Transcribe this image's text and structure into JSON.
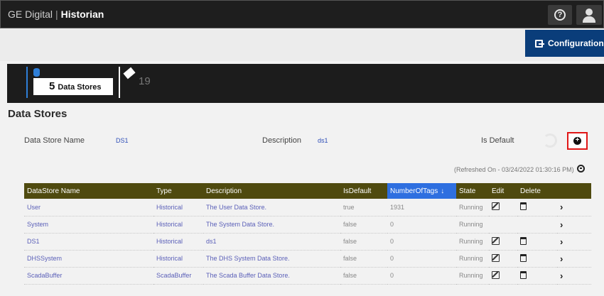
{
  "header": {
    "brand": "GE Digital",
    "app_name": "Historian",
    "help_icon": "help-circle-icon",
    "user_icon": "user-icon"
  },
  "toolbar": {
    "configuration_label": "Configuration",
    "configuration_icon": "configuration-icon"
  },
  "stats": {
    "data_stores_count": "5",
    "data_stores_label": "Data Stores",
    "tags_count": "19"
  },
  "page": {
    "title": "Data Stores"
  },
  "details": {
    "name_label": "Data Store Name",
    "name_value": "DS1",
    "description_label": "Description",
    "description_value": "ds1",
    "is_default_label": "Is Default"
  },
  "refreshed_text": "(Refreshed On - 03/24/2022 01:30:16 PM)",
  "table": {
    "columns": [
      "DataStore Name",
      "Type",
      "Description",
      "IsDefault",
      "NumberOfTags",
      "State",
      "Edit",
      "Delete"
    ],
    "sort_arrow": "↓",
    "rows": [
      {
        "name": "User",
        "type": "Historical",
        "description": "The User Data Store.",
        "is_default": "true",
        "tags": "1931",
        "state": "Running",
        "editable": true,
        "deletable": true
      },
      {
        "name": "System",
        "type": "Historical",
        "description": "The System Data Store.",
        "is_default": "false",
        "tags": "0",
        "state": "Running",
        "editable": false,
        "deletable": false
      },
      {
        "name": "DS1",
        "type": "Historical",
        "description": "ds1",
        "is_default": "false",
        "tags": "0",
        "state": "Running",
        "editable": true,
        "deletable": true
      },
      {
        "name": "DHSSystem",
        "type": "Historical",
        "description": "The DHS System Data Store.",
        "is_default": "false",
        "tags": "0",
        "state": "Running",
        "editable": true,
        "deletable": true
      },
      {
        "name": "ScadaBuffer",
        "type": "ScadaBuffer",
        "description": "The Scada Buffer Data Store.",
        "is_default": "false",
        "tags": "0",
        "state": "Running",
        "editable": true,
        "deletable": true
      }
    ]
  },
  "colors": {
    "header_bg": "#1e1e1e",
    "config_button": "#0a3d7a",
    "table_header": "#4f4a0f",
    "sorted_column": "#2e6fe0",
    "add_highlight": "#e01616",
    "link_text": "#5a5fb8"
  }
}
